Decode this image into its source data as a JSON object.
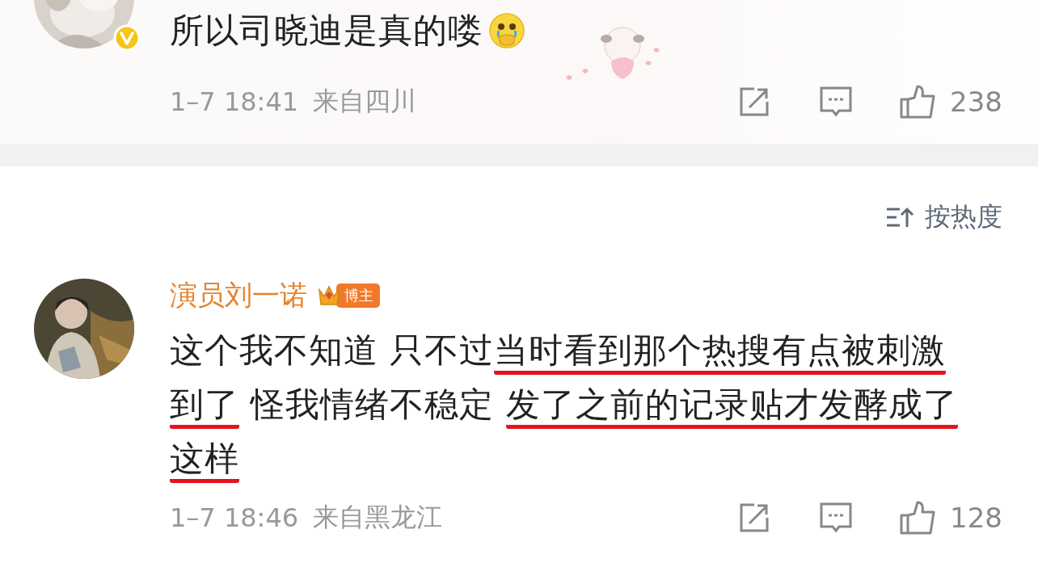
{
  "comments": [
    {
      "verified": true,
      "text": [
        {
          "text": "所以司晓迪是真的喽",
          "underlined": false
        }
      ],
      "emoji": true,
      "sticker": true,
      "date": "1–7 18:41",
      "location": "来自四川",
      "likes": "238"
    },
    {
      "author": "演员刘一诺",
      "badge": "博主",
      "verified": false,
      "text": [
        {
          "text": "这个我不知道 只不过",
          "underlined": false
        },
        {
          "text": "当时看到那个热搜有点被刺激到了",
          "underlined": true
        },
        {
          "text": " 怪我情绪不稳定 ",
          "underlined": false
        },
        {
          "text": "发了之前的记录贴才发酵成了这样",
          "underlined": true
        }
      ],
      "emoji": false,
      "sticker": false,
      "date": "1–7 18:46",
      "location": "来自黑龙江",
      "likes": "128"
    }
  ],
  "sort": {
    "label": "按热度"
  }
}
